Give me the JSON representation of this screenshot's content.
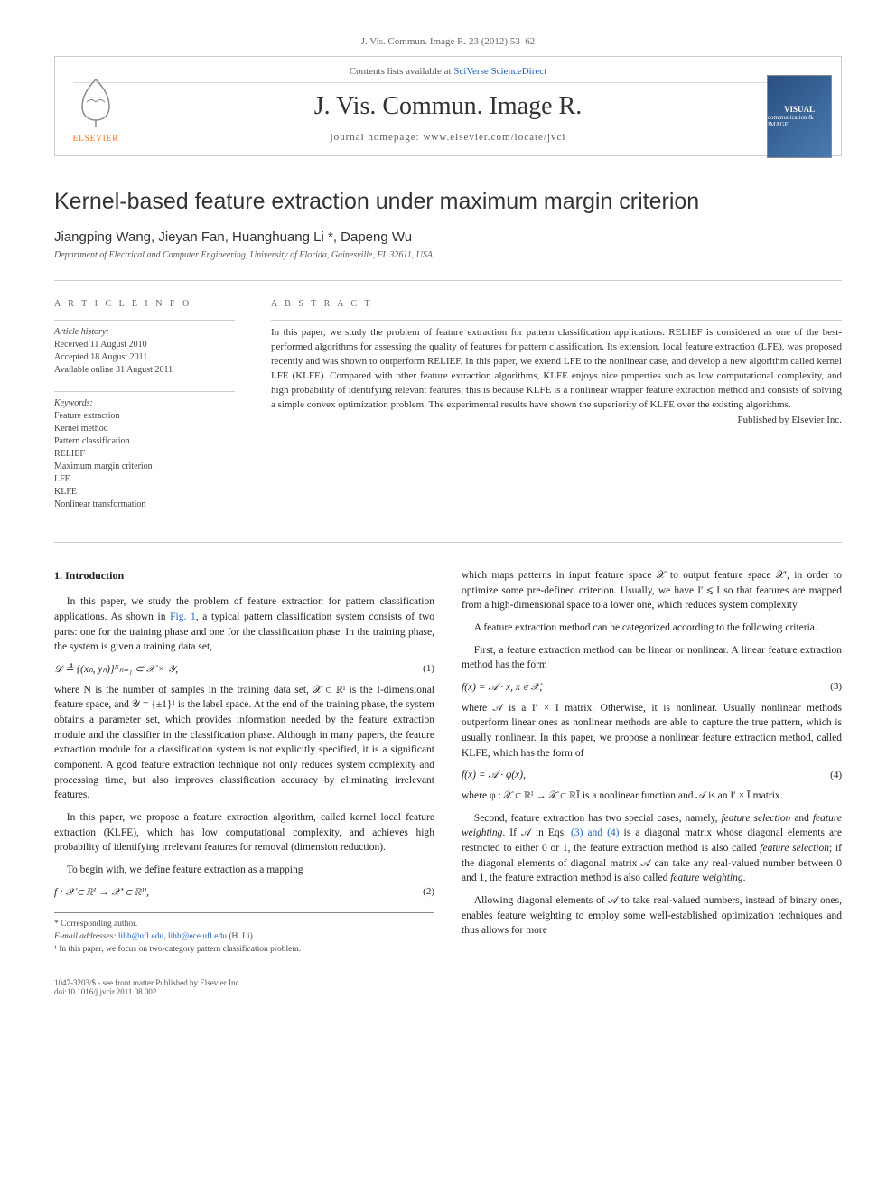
{
  "journal_ref": "J. Vis. Commun. Image R. 23 (2012) 53–62",
  "header": {
    "contents_label": "Contents lists available at ",
    "contents_link": "SciVerse ScienceDirect",
    "journal_name": "J. Vis. Commun. Image R.",
    "homepage_label": "journal homepage: ",
    "homepage_url": "www.elsevier.com/locate/jvci",
    "publisher_name": "ELSEVIER",
    "cover_line1": "VISUAL",
    "cover_line2": "communication & IMAGE"
  },
  "title": "Kernel-based feature extraction under maximum margin criterion",
  "authors": "Jiangping Wang, Jieyan Fan, Huanghuang Li *, Dapeng Wu",
  "affiliation": "Department of Electrical and Computer Engineering, University of Florida, Gainesville, FL 32611, USA",
  "article_info_heading": "A R T I C L E   I N F O",
  "abstract_heading": "A B S T R A C T",
  "history": {
    "title": "Article history:",
    "received": "Received 11 August 2010",
    "accepted": "Accepted 18 August 2011",
    "online": "Available online 31 August 2011"
  },
  "keywords_label": "Keywords:",
  "keywords": [
    "Feature extraction",
    "Kernel method",
    "Pattern classification",
    "RELIEF",
    "Maximum margin criterion",
    "LFE",
    "KLFE",
    "Nonlinear transformation"
  ],
  "abstract": "In this paper, we study the problem of feature extraction for pattern classification applications. RELIEF is considered as one of the best-performed algorithms for assessing the quality of features for pattern classification. Its extension, local feature extraction (LFE), was proposed recently and was shown to outperform RELIEF. In this paper, we extend LFE to the nonlinear case, and develop a new algorithm called kernel LFE (KLFE). Compared with other feature extraction algorithms, KLFE enjoys nice properties such as low computational complexity, and high probability of identifying relevant features; this is because KLFE is a nonlinear wrapper feature extraction method and consists of solving a simple convex optimization problem. The experimental results have shown the superiority of KLFE over the existing algorithms.",
  "publisher_note": "Published by Elsevier Inc.",
  "section1_heading": "1. Introduction",
  "body": {
    "p1a": "In this paper, we study the problem of feature extraction for pattern classification applications. As shown in ",
    "fig1": "Fig. 1",
    "p1b": ", a typical pattern classification system consists of two parts: one for the training phase and one for the classification phase. In the training phase, the system is given a training data set,",
    "eq1": "𝒟 ≜ {(xₙ, yₙ)}ᴺₙ₌₁ ⊂ 𝒳 × 𝒴,",
    "eq1no": "(1)",
    "p2": "where N is the number of samples in the training data set, 𝒳 ⊂ ℝᴵ is the I-dimensional feature space, and 𝒴 = {±1}¹ is the label space. At the end of the training phase, the system obtains a parameter set, which provides information needed by the feature extraction module and the classifier in the classification phase. Although in many papers, the feature extraction module for a classification system is not explicitly specified, it is a significant component. A good feature extraction technique not only reduces system complexity and processing time, but also improves classification accuracy by eliminating irrelevant features.",
    "p3": "In this paper, we propose a feature extraction algorithm, called kernel local feature extraction (KLFE), which has low computational complexity, and achieves high probability of identifying irrelevant features for removal (dimension reduction).",
    "p4": "To begin with, we define feature extraction as a mapping",
    "eq2": "f : 𝒳 ⊂ ℝᴵ → 𝒳′ ⊂ ℝᴵ′,",
    "eq2no": "(2)",
    "p5": "which maps patterns in input feature space 𝒳 to output feature space 𝒳′, in order to optimize some pre-defined criterion. Usually, we have I′ ⩽ I so that features are mapped from a high-dimensional space to a lower one, which reduces system complexity.",
    "p6": "A feature extraction method can be categorized according to the following criteria.",
    "p7": "First, a feature extraction method can be linear or nonlinear. A linear feature extraction method has the form",
    "eq3": "f(x) = 𝒜 · x,    x ∈ 𝒳,",
    "eq3no": "(3)",
    "p8": "where 𝒜 is a I′ × I matrix. Otherwise, it is nonlinear. Usually nonlinear methods outperform linear ones as nonlinear methods are able to capture the true pattern, which is usually nonlinear. In this paper, we propose a nonlinear feature extraction method, called KLFE, which has the form of",
    "eq4": "f(x) = 𝒜 · φ(x),",
    "eq4no": "(4)",
    "p9": "where φ : 𝒳 ⊂ ℝᴵ → 𝒳̄ ⊂ ℝĪ is a nonlinear function and 𝒜 is an I′ × Ī matrix.",
    "p10a": "Second, feature extraction has two special cases, namely, ",
    "p10_fs": "feature selection",
    "p10b": " and ",
    "p10_fw": "feature weighting",
    "p10c": ". If 𝒜 in Eqs. ",
    "p10_link": "(3) and (4)",
    "p10d": " is a diagonal matrix whose diagonal elements are restricted to either 0 or 1, the feature extraction method is also called ",
    "p10e": "; if the diagonal elements of diagonal matrix 𝒜 can take any real-valued number between 0 and 1, the feature extraction method is also called ",
    "p10f": ".",
    "p11": "Allowing diagonal elements of 𝒜 to take real-valued numbers, instead of binary ones, enables feature weighting to employ some well-established optimization techniques and thus allows for more"
  },
  "footnotes": {
    "corresponding": "* Corresponding author.",
    "email_label": "E-mail addresses: ",
    "email1": "lihh@ufl.edu",
    "email2": "lihh@ece.ufl.edu",
    "email_owner": " (H. Li).",
    "note1": "¹ In this paper, we focus on two-category pattern classification problem."
  },
  "copyright": {
    "line1": "1047-3203/$ - see front matter Published by Elsevier Inc.",
    "line2": "doi:10.1016/j.jvcir.2011.08.002"
  }
}
